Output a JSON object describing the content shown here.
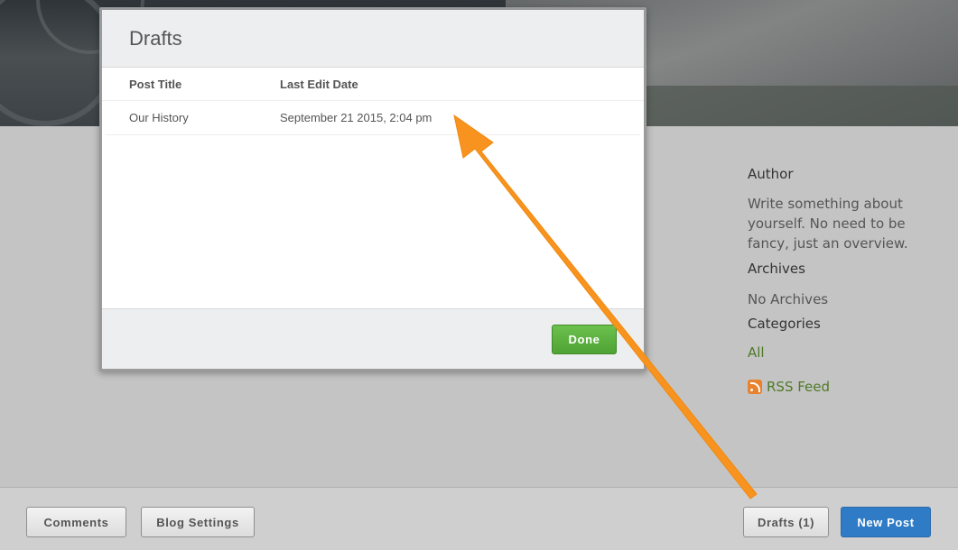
{
  "modal": {
    "title": "Drafts",
    "columns": {
      "post_title": "Post Title",
      "last_edit_date": "Last Edit Date"
    },
    "rows": [
      {
        "title": "Our History",
        "date": "September 21 2015, 2:04 pm"
      }
    ],
    "done_label": "Done"
  },
  "sidebar": {
    "author_title": "Author",
    "author_text": "Write something about yourself. No need to be fancy, just an overview.",
    "archives_title": "Archives",
    "archives_text": "No Archives",
    "categories_title": "Categories",
    "category_all": "All",
    "rss_label": "RSS Feed"
  },
  "toolbar": {
    "comments_label": "Comments",
    "blog_settings_label": "Blog Settings",
    "drafts_label": "Drafts (1)",
    "new_post_label": "New Post"
  },
  "colors": {
    "accent_blue": "#2f7bc6",
    "done_green": "#5cb33f",
    "link_green": "#4f7a28",
    "arrow_orange": "#f7931e"
  }
}
